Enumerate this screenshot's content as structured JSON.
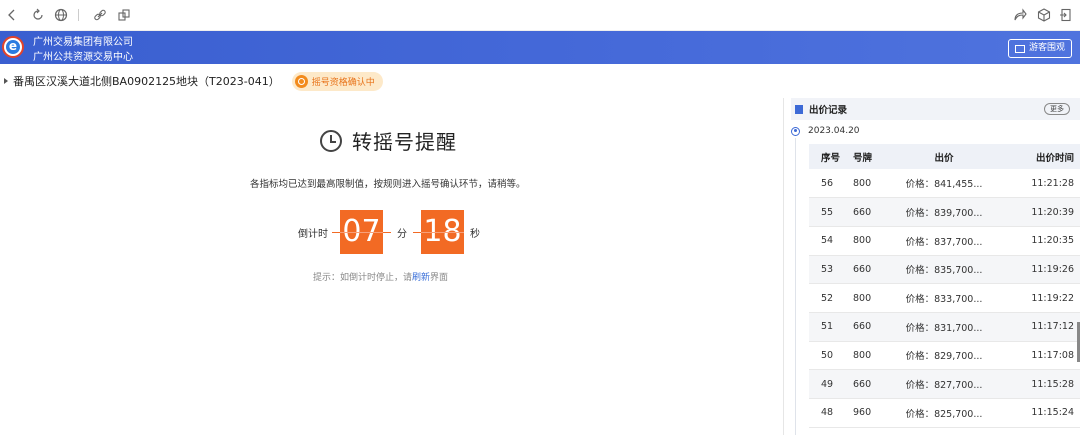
{
  "header": {
    "org_line1": "广州交易集团有限公司",
    "org_line2": "广州公共资源交易中心",
    "guest_button": "游客围观",
    "logo_letter": "e"
  },
  "breadcrumb": {
    "title": "番禺区汉溪大道北侧BA0902125地块（T2023-041）",
    "status": "摇号资格确认中"
  },
  "reminder": {
    "title": "转摇号提醒",
    "description": "各指标均已达到最高限制值，按规则进入摇号确认环节，请稍等。",
    "countdown_label": "倒计时",
    "minutes": "07",
    "minutes_unit": "分",
    "seconds": "18",
    "seconds_unit": "秒",
    "hint_prefix": "提示：如倒计时停止，请",
    "hint_link": "刷新",
    "hint_suffix": "界面"
  },
  "bids": {
    "title": "出价记录",
    "more": "更多",
    "date": "2023.04.20",
    "columns": [
      "序号",
      "号牌",
      "出价",
      "出价时间"
    ],
    "rows": [
      {
        "no": "56",
        "plate": "800",
        "price": "价格：841,455...",
        "time": "11:21:28"
      },
      {
        "no": "55",
        "plate": "660",
        "price": "价格：839,700...",
        "time": "11:20:39"
      },
      {
        "no": "54",
        "plate": "800",
        "price": "价格：837,700...",
        "time": "11:20:35"
      },
      {
        "no": "53",
        "plate": "660",
        "price": "价格：835,700...",
        "time": "11:19:26"
      },
      {
        "no": "52",
        "plate": "800",
        "price": "价格：833,700...",
        "time": "11:19:22"
      },
      {
        "no": "51",
        "plate": "660",
        "price": "价格：831,700...",
        "time": "11:17:12"
      },
      {
        "no": "50",
        "plate": "800",
        "price": "价格：829,700...",
        "time": "11:17:08"
      },
      {
        "no": "49",
        "plate": "660",
        "price": "价格：827,700...",
        "time": "11:15:28"
      },
      {
        "no": "48",
        "plate": "960",
        "price": "价格：825,700...",
        "time": "11:15:24"
      }
    ]
  },
  "icons": {
    "back": "back-icon",
    "refresh": "refresh-icon",
    "globe": "globe-icon",
    "link": "link-icon",
    "copy": "copy-icon",
    "share": "share-icon",
    "cube": "cube-icon",
    "exit": "exit-icon"
  },
  "colors": {
    "header_blue": "#4468d8",
    "countdown_orange": "#f26a24",
    "status_bg": "#fde9c9",
    "status_text": "#e8731a"
  }
}
